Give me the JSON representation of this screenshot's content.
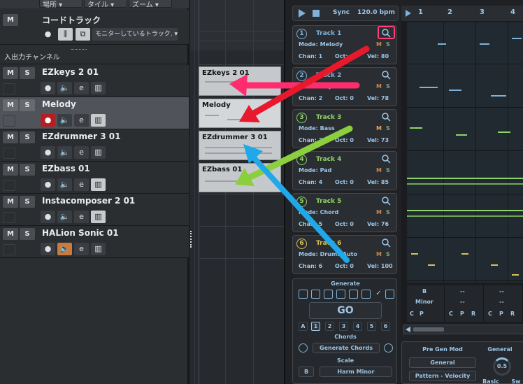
{
  "toolbar": {
    "dd1": "場所",
    "dd2": "タイル",
    "dd3": "ズーム"
  },
  "chord_track": {
    "name": "コードトラック",
    "monitor": "モニターしているトラック.",
    "m": "M"
  },
  "section": {
    "title": "入出力チャンネル"
  },
  "tracks": [
    {
      "name": "EZkeys 2 01",
      "m": "M",
      "s": "S"
    },
    {
      "name": "Melody",
      "m": "M",
      "s": "S"
    },
    {
      "name": "EZdrummer 3 01",
      "m": "M",
      "s": "S"
    },
    {
      "name": "EZbass 01",
      "m": "M",
      "s": "S"
    },
    {
      "name": "Instacomposer 2 01",
      "m": "M",
      "s": "S"
    },
    {
      "name": "HALion Sonic 01",
      "m": "M",
      "s": "S"
    }
  ],
  "parts": [
    "EZkeys 2 01",
    "Melody",
    "EZdrummer 3 01",
    "EZbass 01"
  ],
  "plugin": {
    "transport": {
      "sync": "Sync",
      "bpm": "120.0 bpm"
    },
    "cards": [
      {
        "num": "1",
        "name": "Track 1",
        "mode": "Mode: Melody",
        "chan": "Chan: 1",
        "oct": "Oct: 0",
        "vel": "Vel: 80",
        "m": "M",
        "s": "S",
        "color": "#7fb2d8"
      },
      {
        "num": "2",
        "name": "Track 2",
        "mode": "Mode: Rhythm",
        "chan": "Chan: 2",
        "oct": "Oct: 0",
        "vel": "Vel: 78",
        "m": "M",
        "s": "S",
        "color": "#7fb2d8"
      },
      {
        "num": "3",
        "name": "Track 3",
        "mode": "Mode: Bass",
        "chan": "Chan: 3",
        "oct": "Oct: 0",
        "vel": "Vel: 73",
        "m": "M",
        "s": "S",
        "color": "#8fd36a"
      },
      {
        "num": "4",
        "name": "Track 4",
        "mode": "Mode: Pad",
        "chan": "Chan: 4",
        "oct": "Oct: 0",
        "vel": "Vel: 85",
        "m": "M",
        "s": "S",
        "color": "#8fd36a"
      },
      {
        "num": "5",
        "name": "Track 5",
        "mode": "Mode: Chord",
        "chan": "Chan: 5",
        "oct": "Oct: 0",
        "vel": "Vel: 76",
        "m": "M",
        "s": "S",
        "color": "#8fd36a"
      },
      {
        "num": "6",
        "name": "Track 6",
        "mode": "Mode: Drums Auto",
        "chan": "Chan: 6",
        "oct": "Oct: 0",
        "vel": "Vel: 100",
        "m": "M",
        "s": "S",
        "color": "#d6c25a"
      }
    ],
    "generate": {
      "title": "Generate",
      "go": "GO",
      "slots": [
        "A",
        "1",
        "2",
        "3",
        "4",
        "5",
        "6"
      ],
      "chords_title": "Chords",
      "generate_chords": "Generate Chords",
      "scale_title": "Scale",
      "scale_key": "B",
      "scale_value": "Harm Minor"
    },
    "pianoroll": {
      "bars": [
        "1",
        "2",
        "3",
        "4"
      ],
      "key": "B",
      "scale": "Minor",
      "dashes": [
        "--",
        "--",
        "--",
        "--",
        "--",
        "--"
      ],
      "cpr": [
        "C",
        "P",
        "C",
        "P",
        "R",
        "C",
        "P",
        "R",
        "C",
        "P",
        "R"
      ]
    },
    "bottom": {
      "pregen": "Pre Gen Mod",
      "general_head": "General",
      "general_btn": "General",
      "pattern_btn": "Pattern - Velocity",
      "knob_value": "0.5",
      "basic": "Basic",
      "sw": "Sw"
    }
  },
  "colors": {
    "arrow_red": "#e8192c",
    "arrow_pink": "#ff2d6e",
    "arrow_green": "#8ccf3e",
    "arrow_blue": "#20a8e8"
  }
}
